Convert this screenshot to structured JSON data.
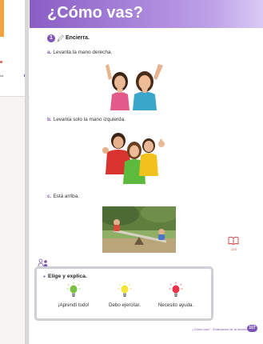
{
  "left_page": {
    "snippet": "sa"
  },
  "header": {
    "title": "¿Cómo vas?"
  },
  "activity": {
    "number": "1",
    "instruction": "Encierra.",
    "items": [
      {
        "letter": "a.",
        "text": "Levanta la mano derecha."
      },
      {
        "letter": "b.",
        "text": "Levanta solo la mano izquierda."
      },
      {
        "letter": "c.",
        "text": "Está arriba."
      }
    ]
  },
  "book_ref": "123",
  "choose": {
    "title": "Elige y explica.",
    "options": [
      {
        "label": "¡Aprendí todo!",
        "icon": "green-bulb-icon",
        "color": "#7cc242"
      },
      {
        "label": "Debo ejercitar.",
        "icon": "yellow-bulb-icon",
        "color": "#f3e53a"
      },
      {
        "label": "Necesito ayuda.",
        "icon": "red-bulb-icon",
        "color": "#e8334a"
      }
    ]
  },
  "footer": {
    "text": "¿Cómo vas? - Evaluación de la lección 15",
    "page": "107"
  }
}
